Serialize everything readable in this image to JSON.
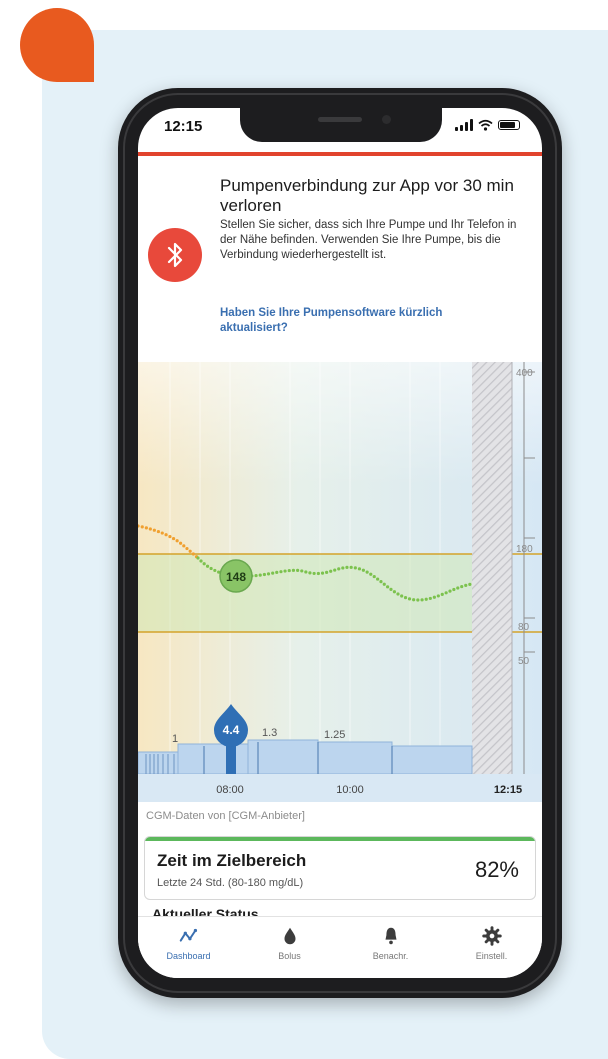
{
  "status_bar": {
    "time": "12:15"
  },
  "alert": {
    "title": "Pumpenverbindung zur App vor 30 min verloren",
    "body": "Stellen Sie sicher, dass sich Ihre Pumpe und Ihr Telefon in der Nähe befinden. Verwenden Sie Ihre Pumpe, bis die Verbindung wiederhergestellt ist.",
    "link": "Haben Sie Ihre Pumpensoftware kürzlich aktualisiert?"
  },
  "chart": {
    "y_labels": {
      "top": "400",
      "upper": "180",
      "lower": "80",
      "bottom": "50"
    },
    "current_value": "148",
    "bolus_value": "4.4",
    "basal_labels": {
      "a": "1",
      "b": "1.3",
      "c": "1.25"
    },
    "x_labels": {
      "t1": "08:00",
      "t2": "10:00",
      "t3": "12:15"
    }
  },
  "source_note": "CGM-Daten von [CGM-Anbieter]",
  "time_in_range": {
    "title": "Zeit im Zielbereich",
    "subtitle": "Letzte 24 Std. (80-180 mg/dL)",
    "percent": "82%"
  },
  "next_section_peek": "Aktueller Status",
  "tabs": [
    {
      "label": "Dashboard",
      "icon": "trend-icon"
    },
    {
      "label": "Bolus",
      "icon": "drop-icon"
    },
    {
      "label": "Benachr.",
      "icon": "bell-icon"
    },
    {
      "label": "Einstell.",
      "icon": "gear-icon"
    }
  ],
  "colors": {
    "accent_orange": "#e85a1f",
    "alert_red": "#e8493b",
    "glucose_green": "#7cc24e",
    "glucose_orange": "#f0a030",
    "range_line": "#d4a32a",
    "bolus_blue": "#2f6fb5",
    "link_blue": "#3a6fb0"
  }
}
